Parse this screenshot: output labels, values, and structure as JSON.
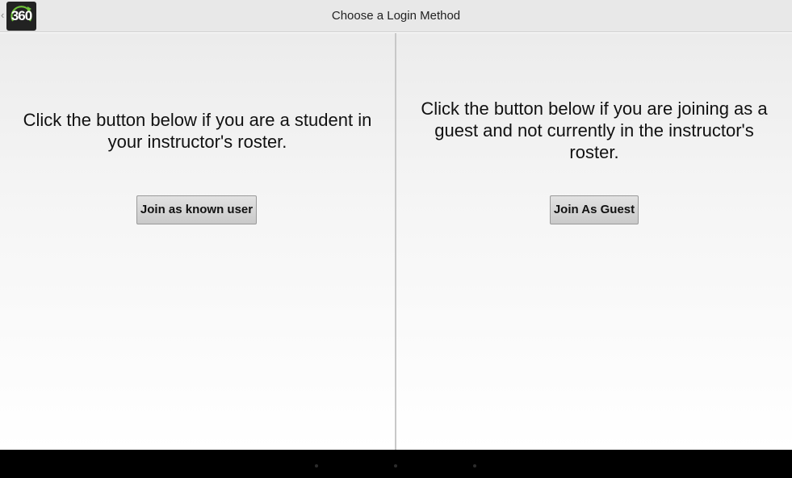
{
  "header": {
    "title": "Choose a Login Method",
    "logo_text": "360",
    "up_caret": "‹",
    "logo_icon": "app-360-logo"
  },
  "panels": {
    "known": {
      "message": "Click the button below if you are a student in your instructor's roster.",
      "button_label": "Join as known user"
    },
    "guest": {
      "message": "Click the button below if you are joining as a guest and not currently in the instructor's roster.",
      "button_label": "Join As Guest"
    }
  },
  "nav_bar": {
    "buttons": [
      "back-icon",
      "home-icon",
      "recent-apps-icon"
    ]
  },
  "colors": {
    "accent_green": "#6fc23a",
    "action_bar": "#e8e8e8",
    "nav_bar": "#000000"
  }
}
